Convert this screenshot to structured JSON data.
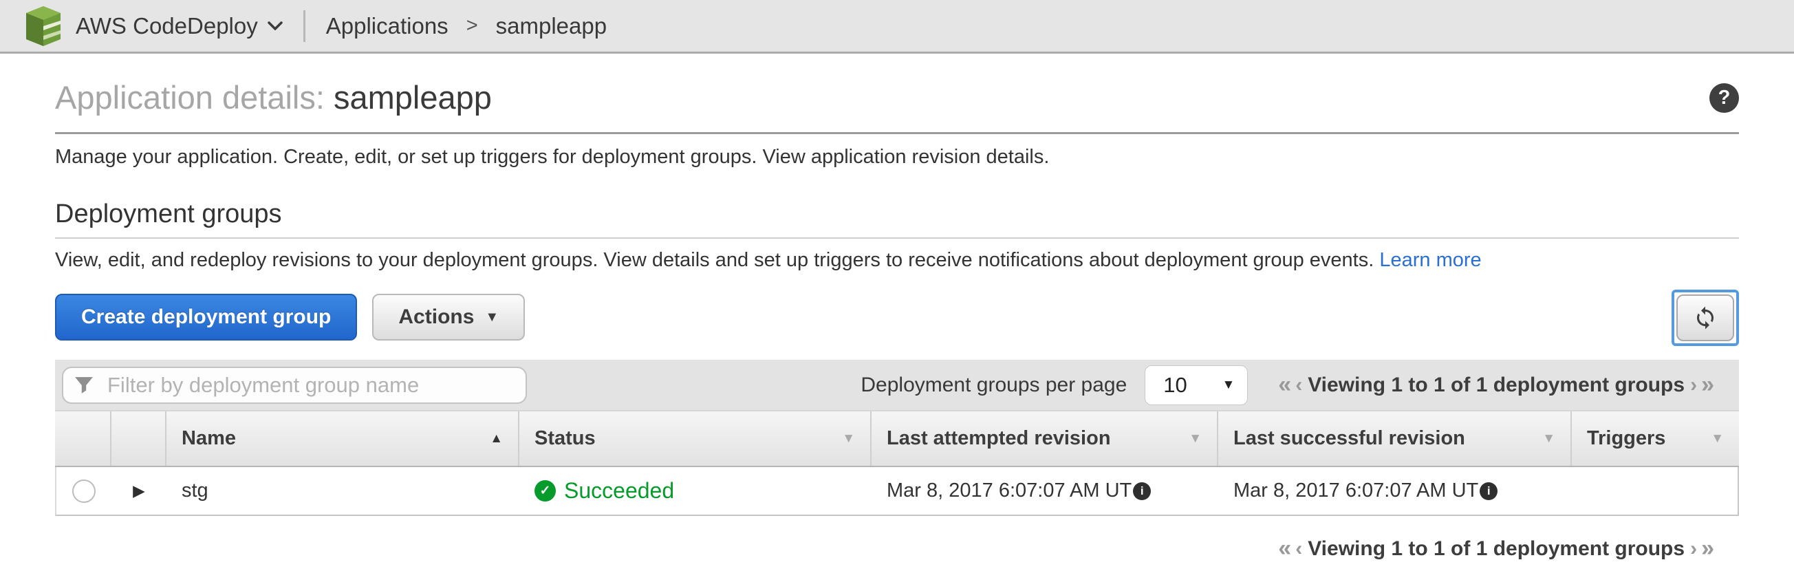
{
  "topbar": {
    "service": "AWS CodeDeploy",
    "breadcrumb_section": "Applications",
    "breadcrumb_sep": ">",
    "breadcrumb_current": "sampleapp"
  },
  "page": {
    "title_prefix": "Application details: ",
    "title_name": "sampleapp",
    "help_glyph": "?",
    "subtitle": "Manage your application. Create, edit, or set up triggers for deployment groups. View application revision details."
  },
  "section": {
    "heading": "Deployment groups",
    "description": "View, edit, and redeploy revisions to your deployment groups. View details and set up triggers to receive notifications about deployment group events.",
    "learn_more": "Learn more"
  },
  "toolbar": {
    "create_label": "Create deployment group",
    "actions_label": "Actions"
  },
  "filter": {
    "placeholder": "Filter by deployment group name",
    "per_page_label": "Deployment groups per page",
    "per_page_value": "10"
  },
  "pagination": {
    "first": "«",
    "prev": "‹",
    "label": "Viewing 1 to 1 of 1 deployment groups",
    "next": "›",
    "last": "»"
  },
  "table": {
    "columns": [
      "Name",
      "Status",
      "Last attempted revision",
      "Last successful revision",
      "Triggers"
    ],
    "row": {
      "name": "stg",
      "status": "Succeeded",
      "last_attempted": "Mar 8, 2017 6:07:07 AM UT",
      "last_successful": "Mar 8, 2017 6:07:07 AM UT",
      "triggers": ""
    }
  },
  "icons": {
    "sort_asc": "▲",
    "caret_down": "▼",
    "expander": "▶",
    "check": "✓",
    "info": "i"
  },
  "colors": {
    "button_blue": "#2f7dd9",
    "link_blue": "#2a6fd1",
    "success_green": "#069b2b",
    "logo_green": "#6f9c3b"
  }
}
